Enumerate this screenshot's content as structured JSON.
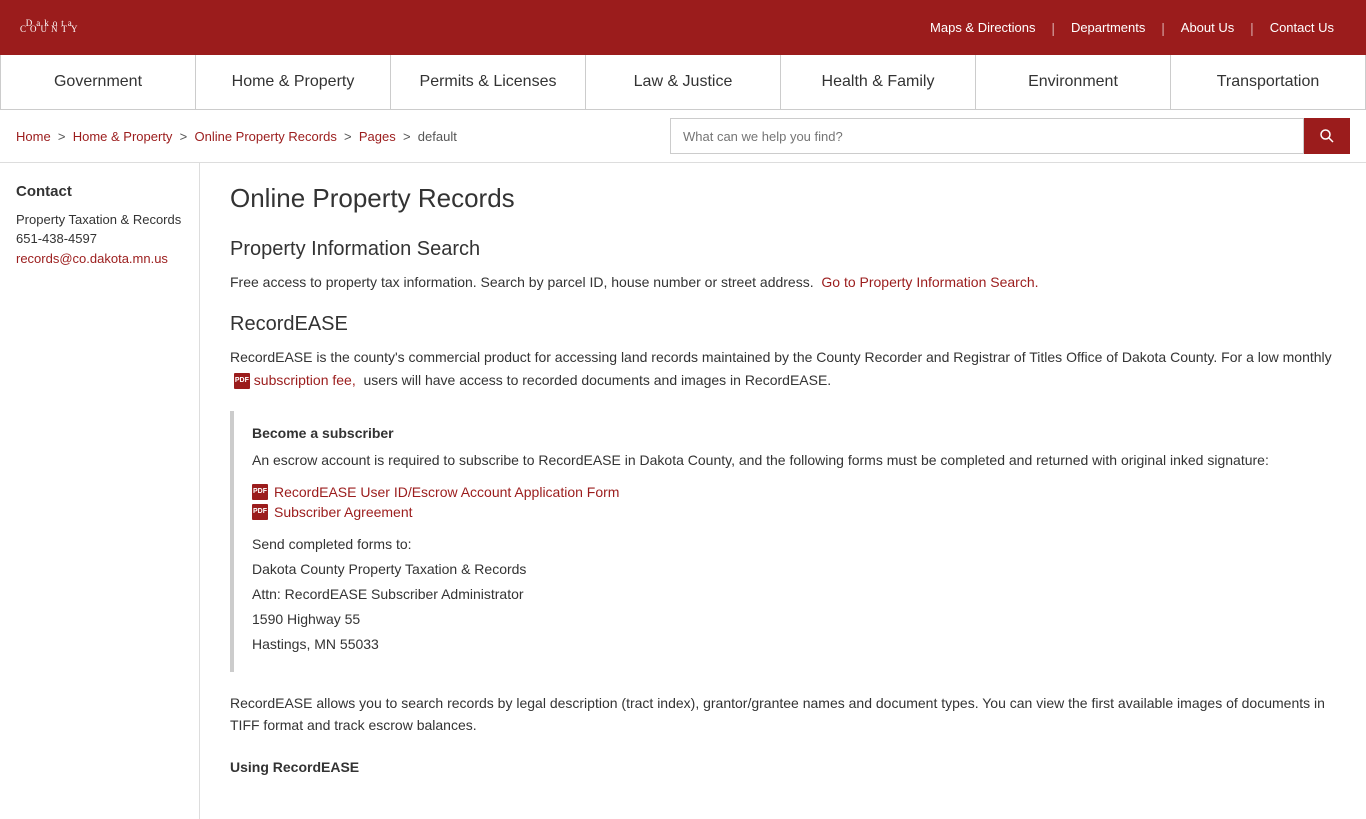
{
  "topbar": {
    "logo_text": "Dakota",
    "logo_sub": "COUNTY",
    "nav_items": [
      {
        "label": "Maps & Directions",
        "url": "#"
      },
      {
        "label": "Departments",
        "url": "#"
      },
      {
        "label": "About Us",
        "url": "#"
      },
      {
        "label": "Contact Us",
        "url": "#"
      }
    ]
  },
  "main_nav": [
    {
      "label": "Government",
      "url": "#"
    },
    {
      "label": "Home & Property",
      "url": "#"
    },
    {
      "label": "Permits & Licenses",
      "url": "#"
    },
    {
      "label": "Law & Justice",
      "url": "#"
    },
    {
      "label": "Health & Family",
      "url": "#"
    },
    {
      "label": "Environment",
      "url": "#"
    },
    {
      "label": "Transportation",
      "url": "#"
    }
  ],
  "breadcrumb": {
    "items": [
      {
        "label": "Home",
        "url": "#"
      },
      {
        "label": "Home & Property",
        "url": "#"
      },
      {
        "label": "Online Property Records",
        "url": "#"
      },
      {
        "label": "Pages",
        "url": "#"
      },
      {
        "label": "default",
        "url": null
      }
    ]
  },
  "search": {
    "placeholder": "What can we help you find?"
  },
  "sidebar": {
    "contact_title": "Contact",
    "org_name": "Property Taxation & Records",
    "phone": "651-438-4597",
    "email": "records@co.dakota.mn.us"
  },
  "main": {
    "page_title": "Online Property Records",
    "sections": [
      {
        "id": "property-info-search",
        "title": "Property Information Search",
        "text": "Free access to property tax information. Search by parcel ID, house number or street address.",
        "link_text": "Go to Property Information Search.",
        "link_url": "#"
      },
      {
        "id": "recordease",
        "title": "RecordEASE",
        "intro": "RecordEASE is the county's commercial product for accessing land records maintained by the County Recorder and Registrar of Titles Office of Dakota County. For a low monthly",
        "subscription_link_text": "subscription fee,",
        "subscription_link_url": "#",
        "intro_end": "users will have access to recorded documents and images in RecordEASE.",
        "callout": {
          "title": "Become a subscriber",
          "text": "An escrow account is required to subscribe to RecordEASE in Dakota County, and the following forms must be completed and returned with original inked signature:",
          "links": [
            {
              "label": "RecordEASE User ID/Escrow Account Application Form",
              "url": "#"
            },
            {
              "label": "Subscriber Agreement",
              "url": "#"
            }
          ],
          "send_label": "Send completed forms to:",
          "address_lines": [
            "Dakota County Property Taxation & Records",
            "Attn: RecordEASE Subscriber Administrator",
            "1590 Highway 55",
            "Hastings, MN 55033"
          ]
        },
        "description": "RecordEASE allows you to search records by legal description (tract index), grantor/grantee names and document types. You can view the first available images of documents in TIFF format and track escrow balances.",
        "using_title": "Using RecordEASE"
      }
    ]
  }
}
